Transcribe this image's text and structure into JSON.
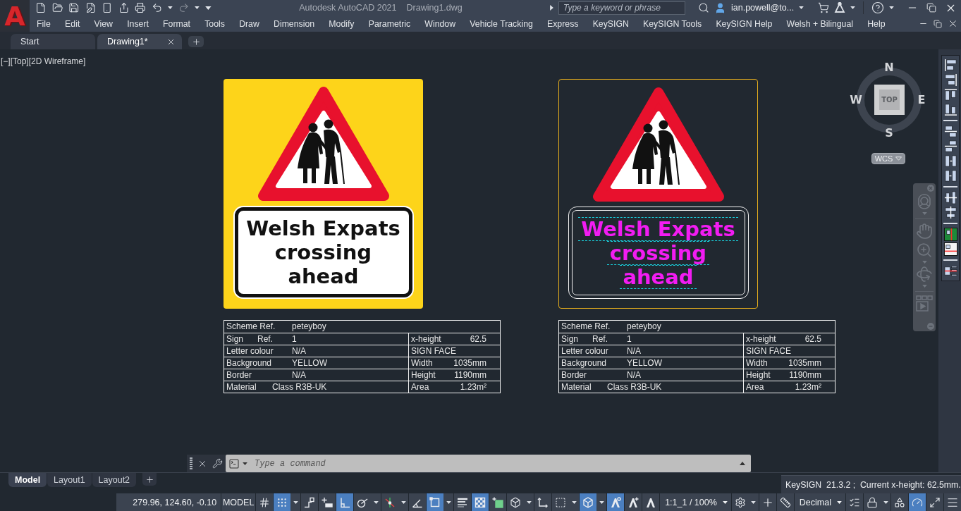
{
  "logo": {
    "letter": "A"
  },
  "title_bar": {
    "app": "Autodesk AutoCAD 2021",
    "document": "Drawing1.dwg",
    "search": {
      "placeholder": "Type a keyword or phrase"
    },
    "user": "ian.powell@to..."
  },
  "menu": [
    "File",
    "Edit",
    "View",
    "Insert",
    "Format",
    "Tools",
    "Draw",
    "Dimension",
    "Modify",
    "Parametric",
    "Window",
    "Vehicle Tracking",
    "Express",
    "KeySIGN",
    "KeySIGN Tools",
    "KeySIGN Help",
    "Welsh + Bilingual",
    "Help"
  ],
  "file_tabs": [
    {
      "label": "Start",
      "selected": false,
      "closable": false
    },
    {
      "label": "Drawing1*",
      "selected": true,
      "closable": true
    }
  ],
  "viewport": {
    "label": "[−][Top][2D Wireframe]"
  },
  "signs": [
    {
      "kind": "filled",
      "lines": [
        "Welsh Expats",
        "crossing",
        "ahead"
      ],
      "table": {
        "rows": [
          {
            "kind": "label_value",
            "cells": [
              "Scheme Ref.",
              "peteyboy"
            ]
          },
          {
            "kind": "label_value",
            "cells": [
              "Sign      Ref.",
              "1"
            ],
            "side": [
              "x-height",
              "62.5"
            ]
          },
          {
            "kind": "label_value",
            "cells": [
              "Letter colour",
              "N/A"
            ],
            "side": [
              "SIGN FACE"
            ]
          },
          {
            "kind": "label_value",
            "cells": [
              "Background",
              "YELLOW"
            ],
            "side": [
              "Width",
              "1035mm"
            ]
          },
          {
            "kind": "label_value",
            "cells": [
              "Border",
              "N/A"
            ],
            "side": [
              "Height",
              "1190mm"
            ]
          },
          {
            "kind": "long_value",
            "cells": [
              "Material",
              "Class R3B-UK"
            ],
            "side": [
              "Area",
              "1.23m²"
            ]
          }
        ]
      }
    },
    {
      "kind": "outline",
      "lines": [
        "Welsh Expats",
        "crossing",
        "ahead"
      ],
      "table": {
        "rows": [
          {
            "kind": "label_value",
            "cells": [
              "Scheme Ref.",
              "peteyboy"
            ]
          },
          {
            "kind": "label_value",
            "cells": [
              "Sign      Ref.",
              "1"
            ],
            "side": [
              "x-height",
              "62.5"
            ]
          },
          {
            "kind": "label_value",
            "cells": [
              "Letter colour",
              "N/A"
            ],
            "side": [
              "SIGN FACE"
            ]
          },
          {
            "kind": "label_value",
            "cells": [
              "Background",
              "YELLOW"
            ],
            "side": [
              "Width",
              "1035mm"
            ]
          },
          {
            "kind": "label_value",
            "cells": [
              "Border",
              "N/A"
            ],
            "side": [
              "Height",
              "1190mm"
            ]
          },
          {
            "kind": "long_value",
            "cells": [
              "Material",
              "Class R3B-UK"
            ],
            "side": [
              "Area",
              "1.23m²"
            ]
          }
        ]
      }
    }
  ],
  "viewcube": {
    "face": "TOP",
    "north": "N",
    "east": "E",
    "south": "S",
    "west": "W",
    "ucs": "WCS"
  },
  "command_line": {
    "placeholder": "Type a command"
  },
  "layout_tabs": [
    {
      "label": "Model",
      "selected": true
    },
    {
      "label": "Layout1",
      "selected": false
    },
    {
      "label": "Layout2",
      "selected": false
    }
  ],
  "keysign_status": "KeySIGN  21.3.2 ;  Current x-height: 62.5mm.",
  "status_bar": {
    "items": [
      {
        "kind": "coordinates",
        "text": "279.96, 124.60, -0.10"
      },
      {
        "kind": "space",
        "text": "MODEL"
      },
      {
        "kind": "toggle",
        "on": false,
        "menu": false
      },
      {
        "kind": "toggle",
        "on": true,
        "menu": true
      },
      {
        "kind": "toggle",
        "on": false,
        "menu": false
      },
      {
        "kind": "toggle",
        "on": false,
        "menu": false
      },
      {
        "kind": "toggle",
        "on": true,
        "menu": false
      },
      {
        "kind": "toggle",
        "on": false,
        "menu": true
      },
      {
        "kind": "toggle",
        "on": false,
        "menu": true
      },
      {
        "kind": "toggle",
        "on": false,
        "menu": false
      },
      {
        "kind": "toggle",
        "on": true,
        "menu": true
      },
      {
        "kind": "toggle",
        "on": false,
        "menu": false
      },
      {
        "kind": "toggle",
        "on": true,
        "menu": false
      },
      {
        "kind": "toggle",
        "on": false,
        "menu": false
      },
      {
        "kind": "toggle",
        "on": false,
        "menu": true
      },
      {
        "kind": "toggle",
        "on": false,
        "menu": false
      },
      {
        "kind": "toggle",
        "on": false,
        "menu": true
      },
      {
        "kind": "toggle",
        "on": true,
        "menu": true
      },
      {
        "kind": "toggle",
        "on": true,
        "menu": false
      },
      {
        "kind": "toggle",
        "on": false,
        "menu": false
      },
      {
        "kind": "toggle",
        "on": false,
        "menu": false
      },
      {
        "kind": "dropdown",
        "text": "1:1_1 / 100%"
      },
      {
        "kind": "toggle",
        "on": false,
        "menu": true
      },
      {
        "kind": "toggle",
        "on": false,
        "menu": false
      },
      {
        "kind": "toggle",
        "on": false,
        "menu": false
      },
      {
        "kind": "dropdown",
        "text": "Decimal"
      },
      {
        "kind": "toggle",
        "on": false,
        "menu": false
      },
      {
        "kind": "toggle",
        "on": false,
        "menu": true
      },
      {
        "kind": "toggle",
        "on": false,
        "menu": false
      },
      {
        "kind": "toggle",
        "on": true,
        "menu": false
      },
      {
        "kind": "toggle",
        "on": false,
        "menu": false
      },
      {
        "kind": "toggle",
        "on": false,
        "menu": false
      }
    ]
  }
}
